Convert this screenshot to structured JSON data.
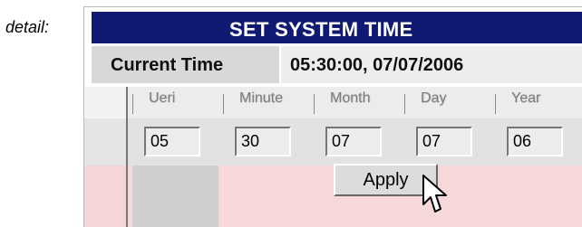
{
  "caption": "detail:",
  "panel": {
    "title": "SET SYSTEM TIME",
    "current_time_label": "Current Time",
    "current_time_value": "05:30:00, 07/07/2006"
  },
  "fields": [
    {
      "label": "Ueri",
      "value": "05"
    },
    {
      "label": "Minute",
      "value": "30"
    },
    {
      "label": "Month",
      "value": "07"
    },
    {
      "label": "Day",
      "value": "07"
    },
    {
      "label": "Year",
      "value": "06"
    }
  ],
  "actions": {
    "apply_label": "Apply"
  },
  "icons": {
    "cursor": "mouse-pointer-icon"
  },
  "colors": {
    "title_bar": "#101a73",
    "label_cell": "#d8d8d8",
    "value_cell": "#ededed",
    "action_band": "#f7d8da"
  }
}
